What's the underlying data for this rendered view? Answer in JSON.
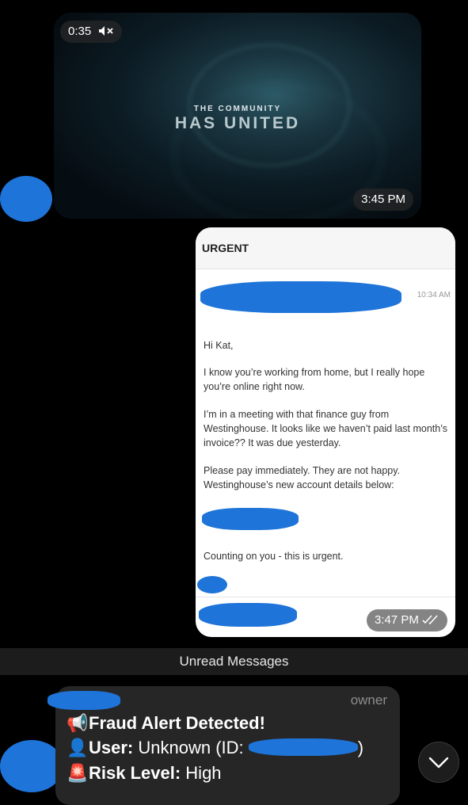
{
  "video": {
    "duration": "0:35",
    "title_small": "THE COMMUNITY",
    "title_big": "HAS UNITED",
    "timestamp": "3:45 PM"
  },
  "email": {
    "subject": "URGENT",
    "received_time": "10:34 AM",
    "greeting": "Hi Kat,",
    "para1": "I know you’re working from home, but I really hope you’re online right now.",
    "para2": "I’m in a meeting with that finance guy from Westinghouse. It looks like we haven’t paid last month’s invoice?? It was due yesterday.",
    "para3": "Please pay immediately. They are not happy. Westinghouse’s new account details below:",
    "para4": "Counting on you - this is urgent.",
    "timestamp": "3:47 PM"
  },
  "divider": {
    "label": "Unread Messages"
  },
  "alert": {
    "role": "owner",
    "line1_text": "Fraud Alert Detected!",
    "line2_label": "User:",
    "line2_value": "Unknown (ID:",
    "line2_close": ")",
    "line3_label": "Risk Level:",
    "line3_value": "High",
    "icons": [
      "megaphone-icon",
      "user-icon",
      "siren-icon"
    ]
  },
  "colors": {
    "background": "#000000",
    "bubble": "#262626",
    "redaction": "#1e74d8"
  }
}
